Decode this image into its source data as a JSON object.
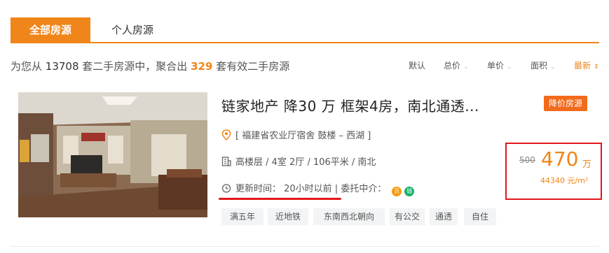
{
  "tabs": [
    {
      "label": "全部房源"
    },
    {
      "label": "个人房源"
    }
  ],
  "summary": {
    "prefix": "为您从",
    "total": "13708",
    "middle": "套二手房源中，聚合出",
    "valid": "329",
    "suffix": "套有效二手房源"
  },
  "sort": [
    {
      "label": "默认"
    },
    {
      "label": "总价"
    },
    {
      "label": "单价"
    },
    {
      "label": "面积"
    },
    {
      "label": "最新"
    }
  ],
  "listing": {
    "title": "链家地产 降30 万  框架4房，南北通透...",
    "badge": "降价房源",
    "address": "[ 福建省农业厅宿舍  鼓楼 – 西湖 ]",
    "details": "高楼层 / 4室 2厅 / 106平米 / 南北",
    "update": "更新时间：  20小时以前 | 委托中介：",
    "agents": [
      "贝",
      "链"
    ],
    "tags": [
      "满五年",
      "近地铁",
      "东南西北朝向",
      "有公交",
      "通透",
      "自住"
    ],
    "price": {
      "old": "500",
      "total": "470",
      "unit": "万",
      "per_sqm": "44340 元/m²"
    }
  },
  "colors": {
    "accent": "#f08519",
    "badge": "#f26a1b",
    "highlight_box": "#e4151a"
  }
}
